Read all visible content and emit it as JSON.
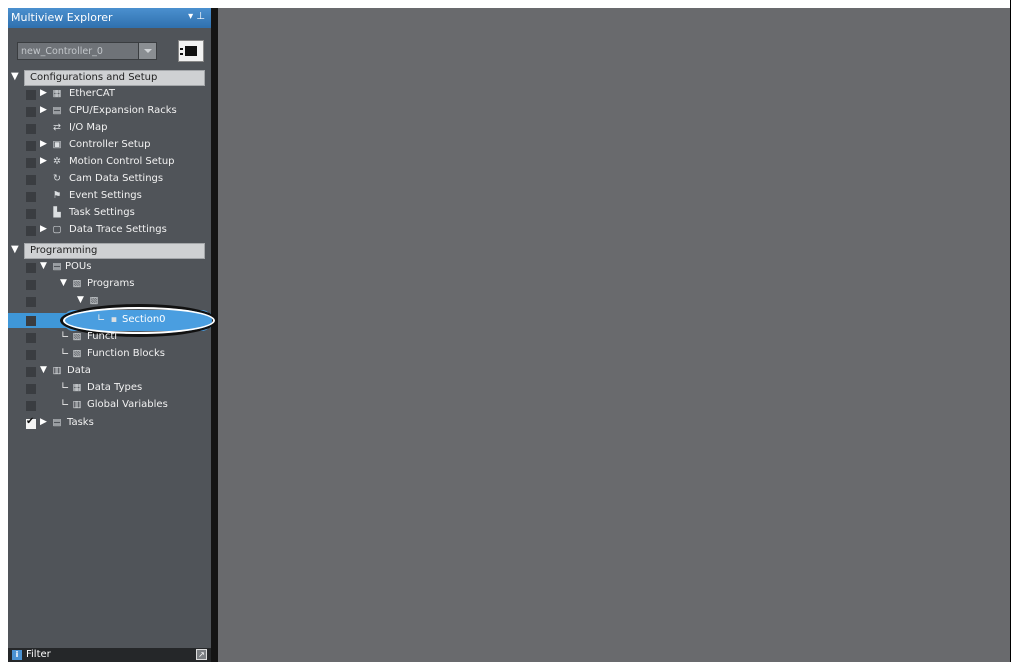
{
  "explorer": {
    "title": "Multiview Explorer",
    "pin_glyph": "▾ ⊥",
    "controller_select": "new_Controller_0",
    "controller_icon": "controller-icon"
  },
  "sections": [
    {
      "label": "Configurations and Setup",
      "items": [
        {
          "label": "EtherCAT",
          "icon": "ethercat-icon",
          "expand": "▶"
        },
        {
          "label": "CPU/Expansion Racks",
          "icon": "rack-icon",
          "expand": "▶"
        },
        {
          "label": "I/O Map",
          "icon": "io-map-icon",
          "expand": ""
        },
        {
          "label": "Controller Setup",
          "icon": "controller-setup-icon",
          "expand": "▶"
        },
        {
          "label": "Motion Control Setup",
          "icon": "motion-gear-icon",
          "expand": "▶"
        },
        {
          "label": "Cam Data Settings",
          "icon": "cam-icon",
          "expand": ""
        },
        {
          "label": "Event Settings",
          "icon": "event-flag-icon",
          "expand": ""
        },
        {
          "label": "Task Settings",
          "icon": "task-settings-icon",
          "expand": ""
        },
        {
          "label": "Data Trace Settings",
          "icon": "data-trace-icon",
          "expand": "▶"
        }
      ]
    },
    {
      "label": "Programming",
      "items": [
        {
          "label": "POUs",
          "icon": "pou-icon",
          "expand": "▼"
        },
        {
          "label": "Programs",
          "icon": "programs-icon",
          "expand": "▼"
        },
        {
          "label": "",
          "icon": "program-icon",
          "expand": "▼"
        },
        {
          "label": "Section0",
          "icon": "section-icon",
          "expand": "",
          "selected": true
        },
        {
          "label": "Functi",
          "icon": "functions-icon",
          "expand": ""
        },
        {
          "label": "Function Blocks",
          "icon": "function-blocks-icon",
          "expand": ""
        },
        {
          "label": "Data",
          "icon": "data-icon",
          "expand": "▼"
        },
        {
          "label": "Data Types",
          "icon": "data-types-icon",
          "expand": ""
        },
        {
          "label": "Global Variables",
          "icon": "global-variables-icon",
          "expand": ""
        },
        {
          "label": "Tasks",
          "icon": "tasks-icon",
          "expand": "▶"
        }
      ]
    }
  ],
  "filter": {
    "label": "Filter",
    "info_glyph": "i",
    "button_glyph": "↗"
  },
  "colors": {
    "panel": "#505459",
    "editor": "#696a6d",
    "selection": "#3f97d8",
    "title_bar": "#3a7fc0"
  }
}
